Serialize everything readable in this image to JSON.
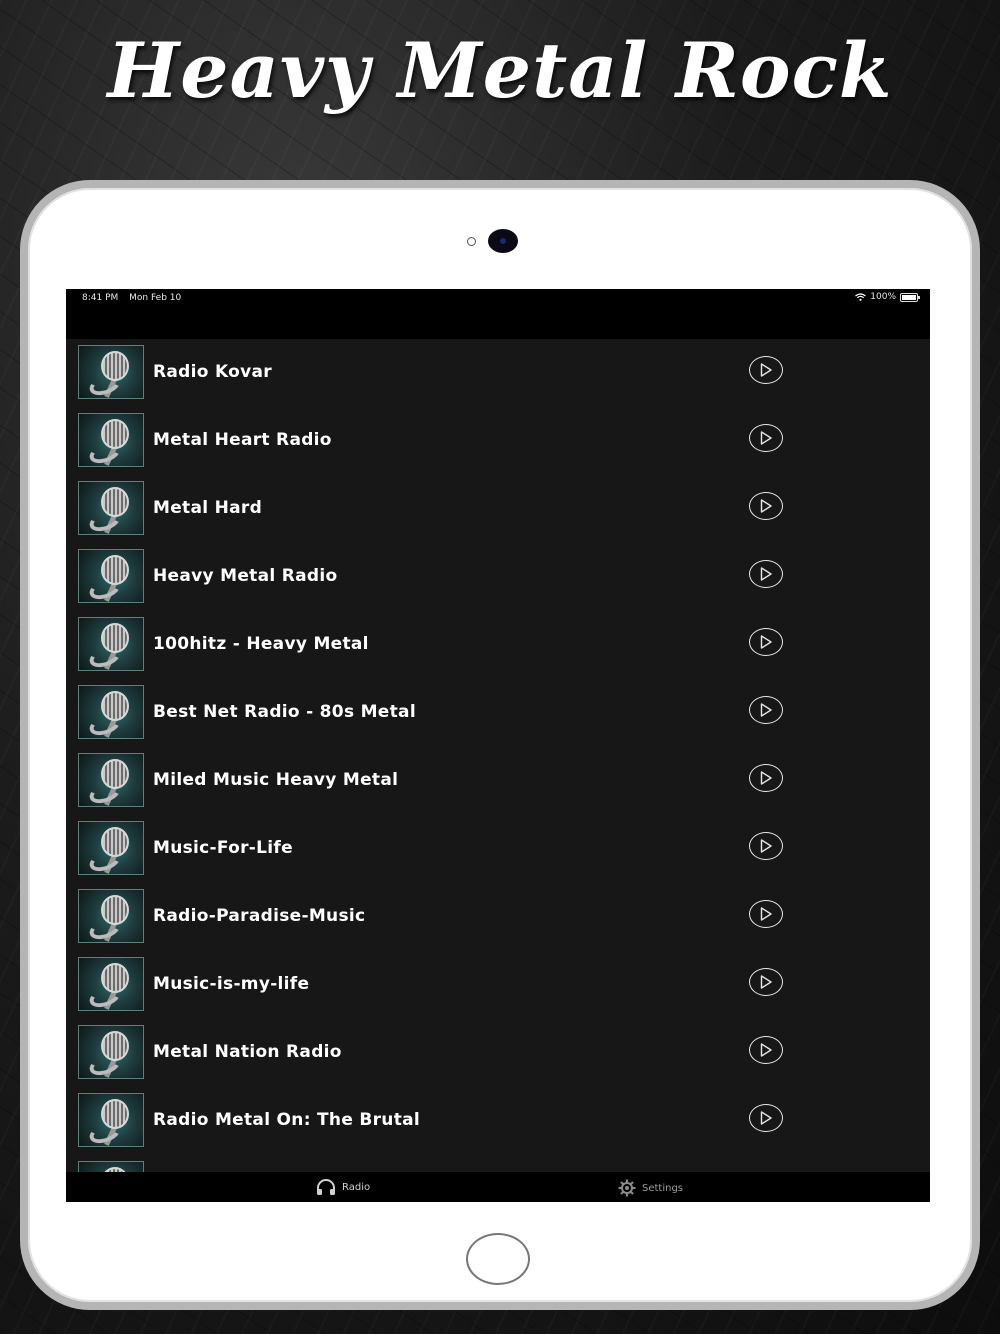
{
  "headline": "Heavy Metal Rock",
  "status_bar": {
    "time": "8:41 PM",
    "date": "Mon Feb 10",
    "battery": "100%"
  },
  "stations": [
    {
      "name": "Radio Kovar"
    },
    {
      "name": "Metal Heart Radio"
    },
    {
      "name": "Metal Hard"
    },
    {
      "name": "Heavy Metal Radio"
    },
    {
      "name": "100hitz - Heavy Metal"
    },
    {
      "name": "Best Net Radio - 80s Metal"
    },
    {
      "name": "Miled Music Heavy Metal"
    },
    {
      "name": "Music-For-Life"
    },
    {
      "name": "Radio-Paradise-Music"
    },
    {
      "name": "Music-is-my-life"
    },
    {
      "name": "Metal Nation Radio"
    },
    {
      "name": "Radio Metal On: The Brutal"
    }
  ],
  "tab_bar": {
    "radio_label": "Radio",
    "settings_label": "Settings",
    "radio_icon": "headphones-icon",
    "settings_icon": "gear-icon"
  }
}
